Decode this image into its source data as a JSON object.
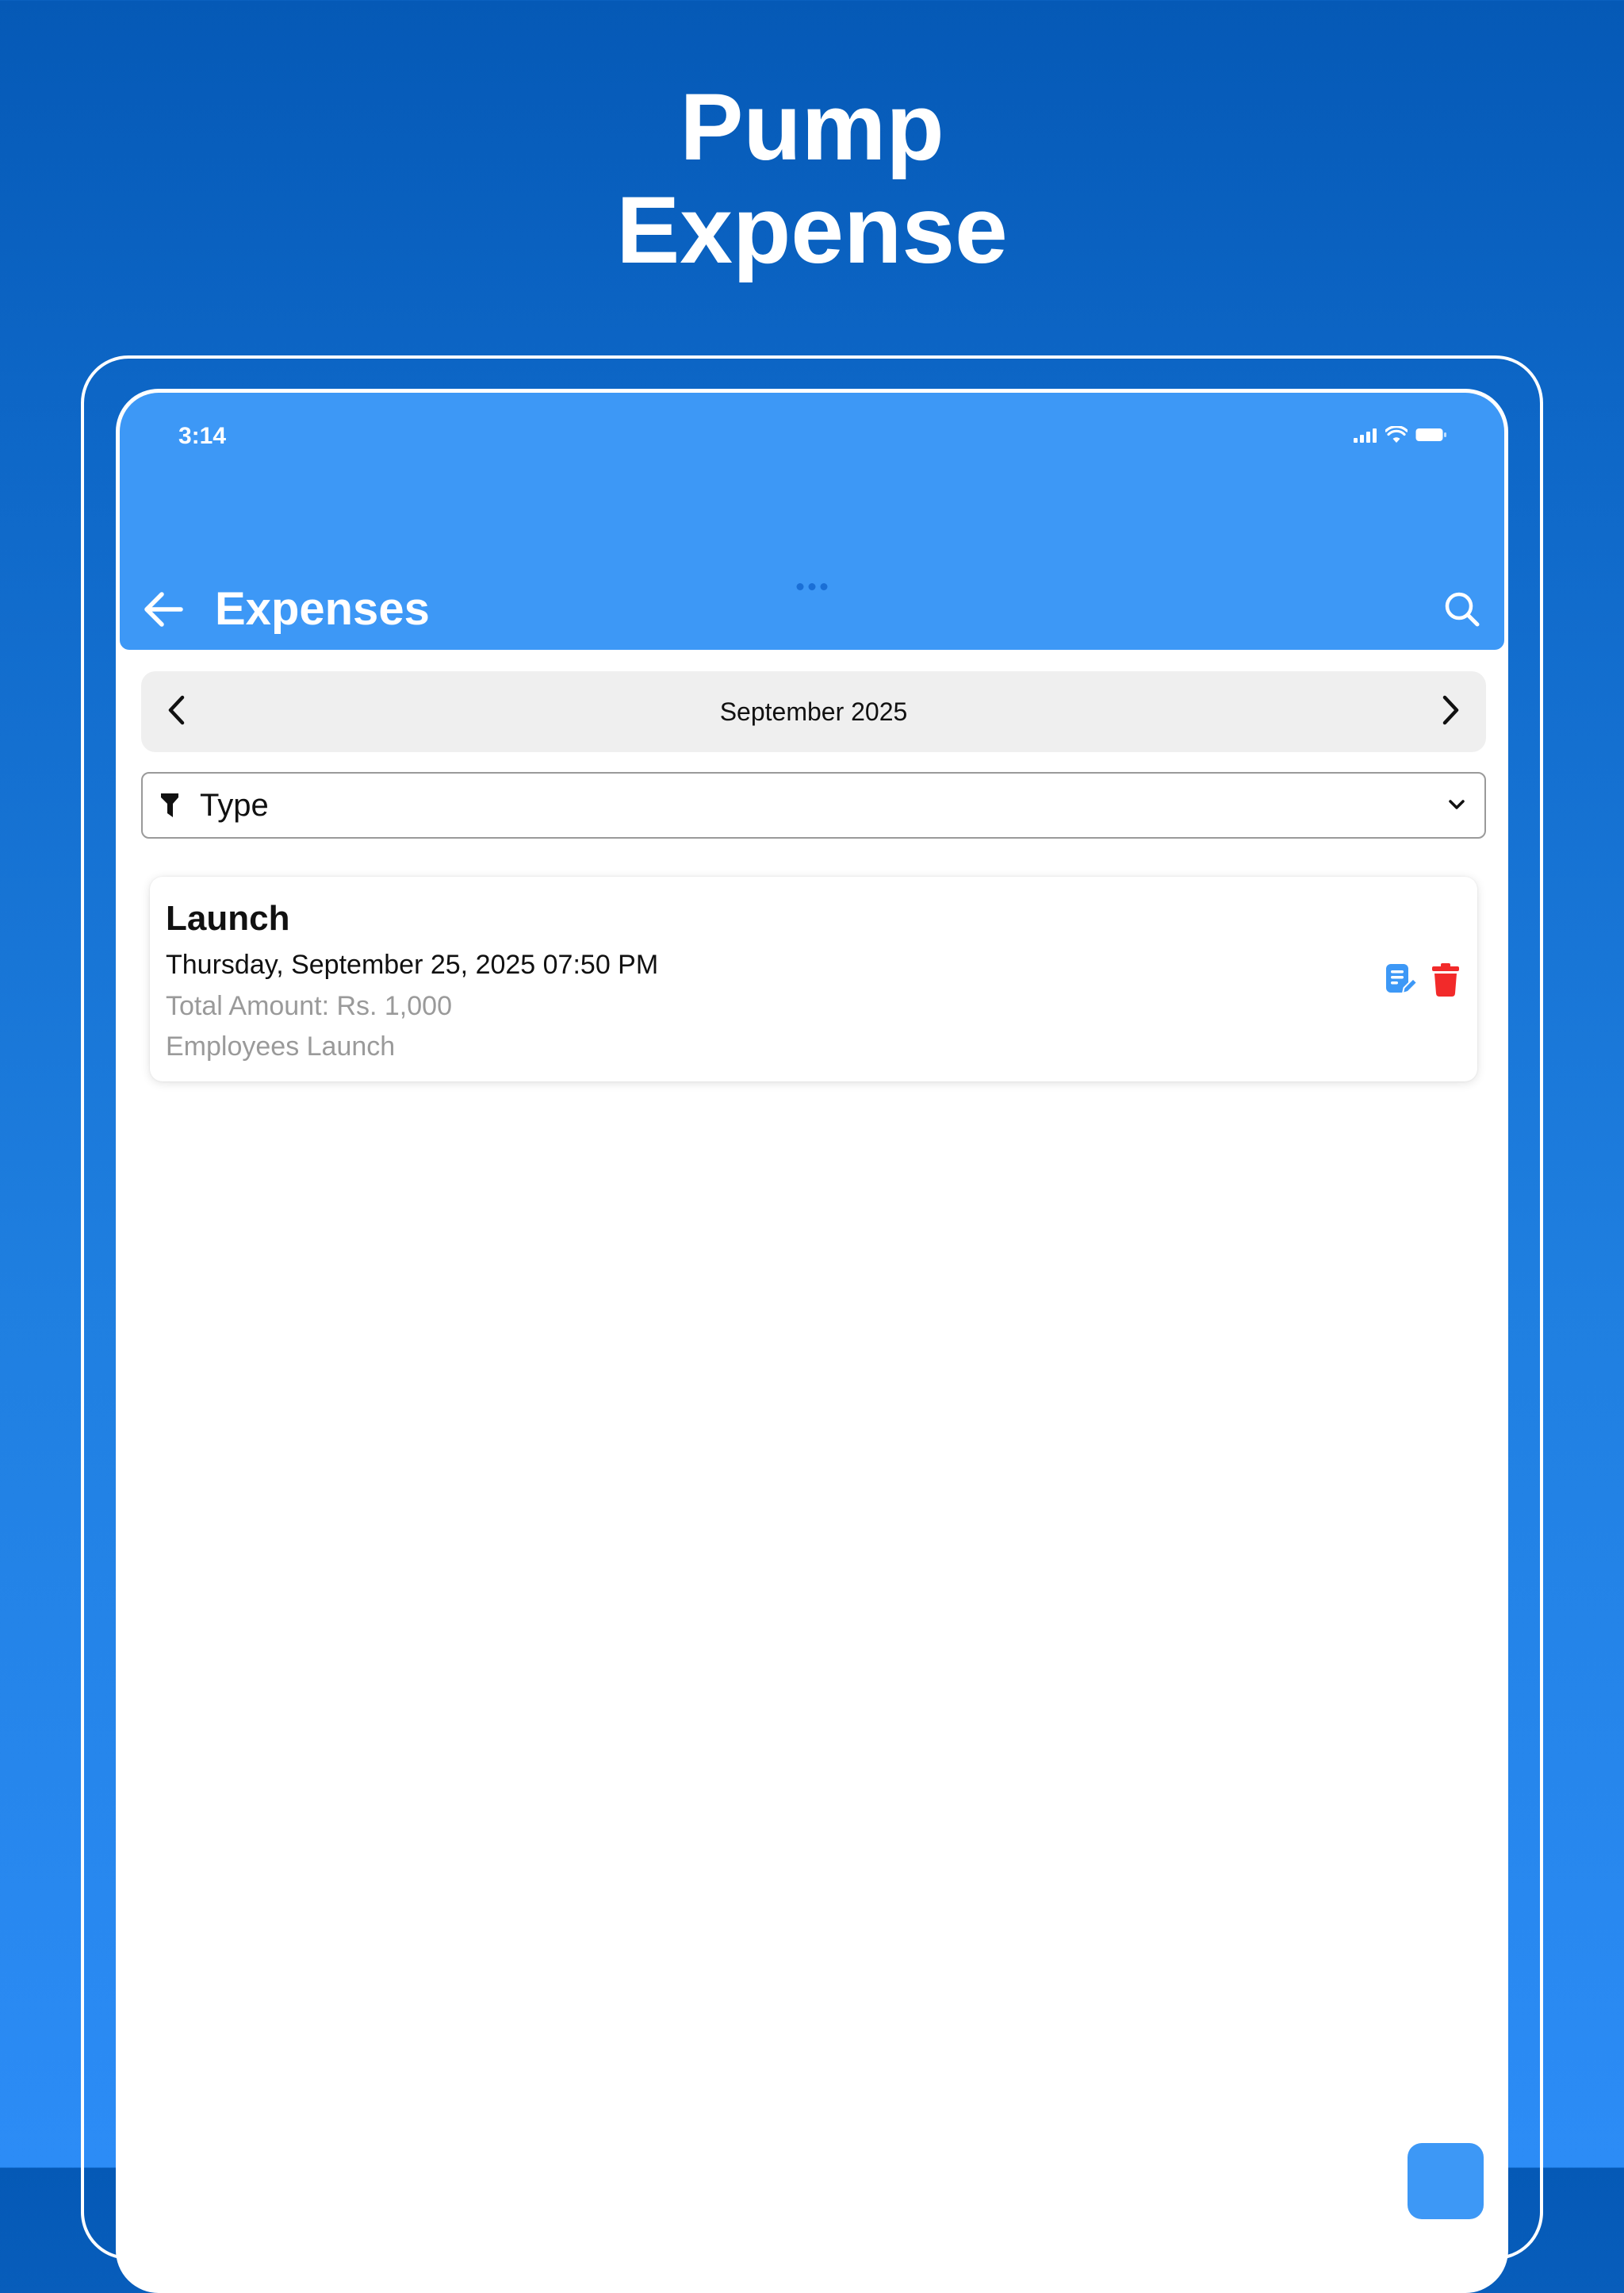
{
  "marketing": {
    "title_line1": "Pump",
    "title_line2": "Expense"
  },
  "status_bar": {
    "time": "3:14",
    "icons": [
      "signal-icon",
      "wifi-icon",
      "battery-icon"
    ]
  },
  "header": {
    "title": "Expenses",
    "back_icon": "arrow-left-icon",
    "search_icon": "search-icon"
  },
  "month_selector": {
    "label": "September 2025",
    "prev_icon": "chevron-left-icon",
    "next_icon": "chevron-right-icon"
  },
  "filter": {
    "label": "Type",
    "icon": "filter-icon",
    "dropdown_icon": "chevron-down-icon"
  },
  "expenses": [
    {
      "title": "Launch",
      "datetime": "Thursday, September 25, 2025 07:50 PM",
      "amount": "Total Amount: Rs. 1,000",
      "note": "Employees Launch"
    }
  ],
  "colors": {
    "primary": "#3d98f6",
    "edit": "#3d98f6",
    "delete": "#f22a2a",
    "muted_text": "#9a9a9a"
  }
}
